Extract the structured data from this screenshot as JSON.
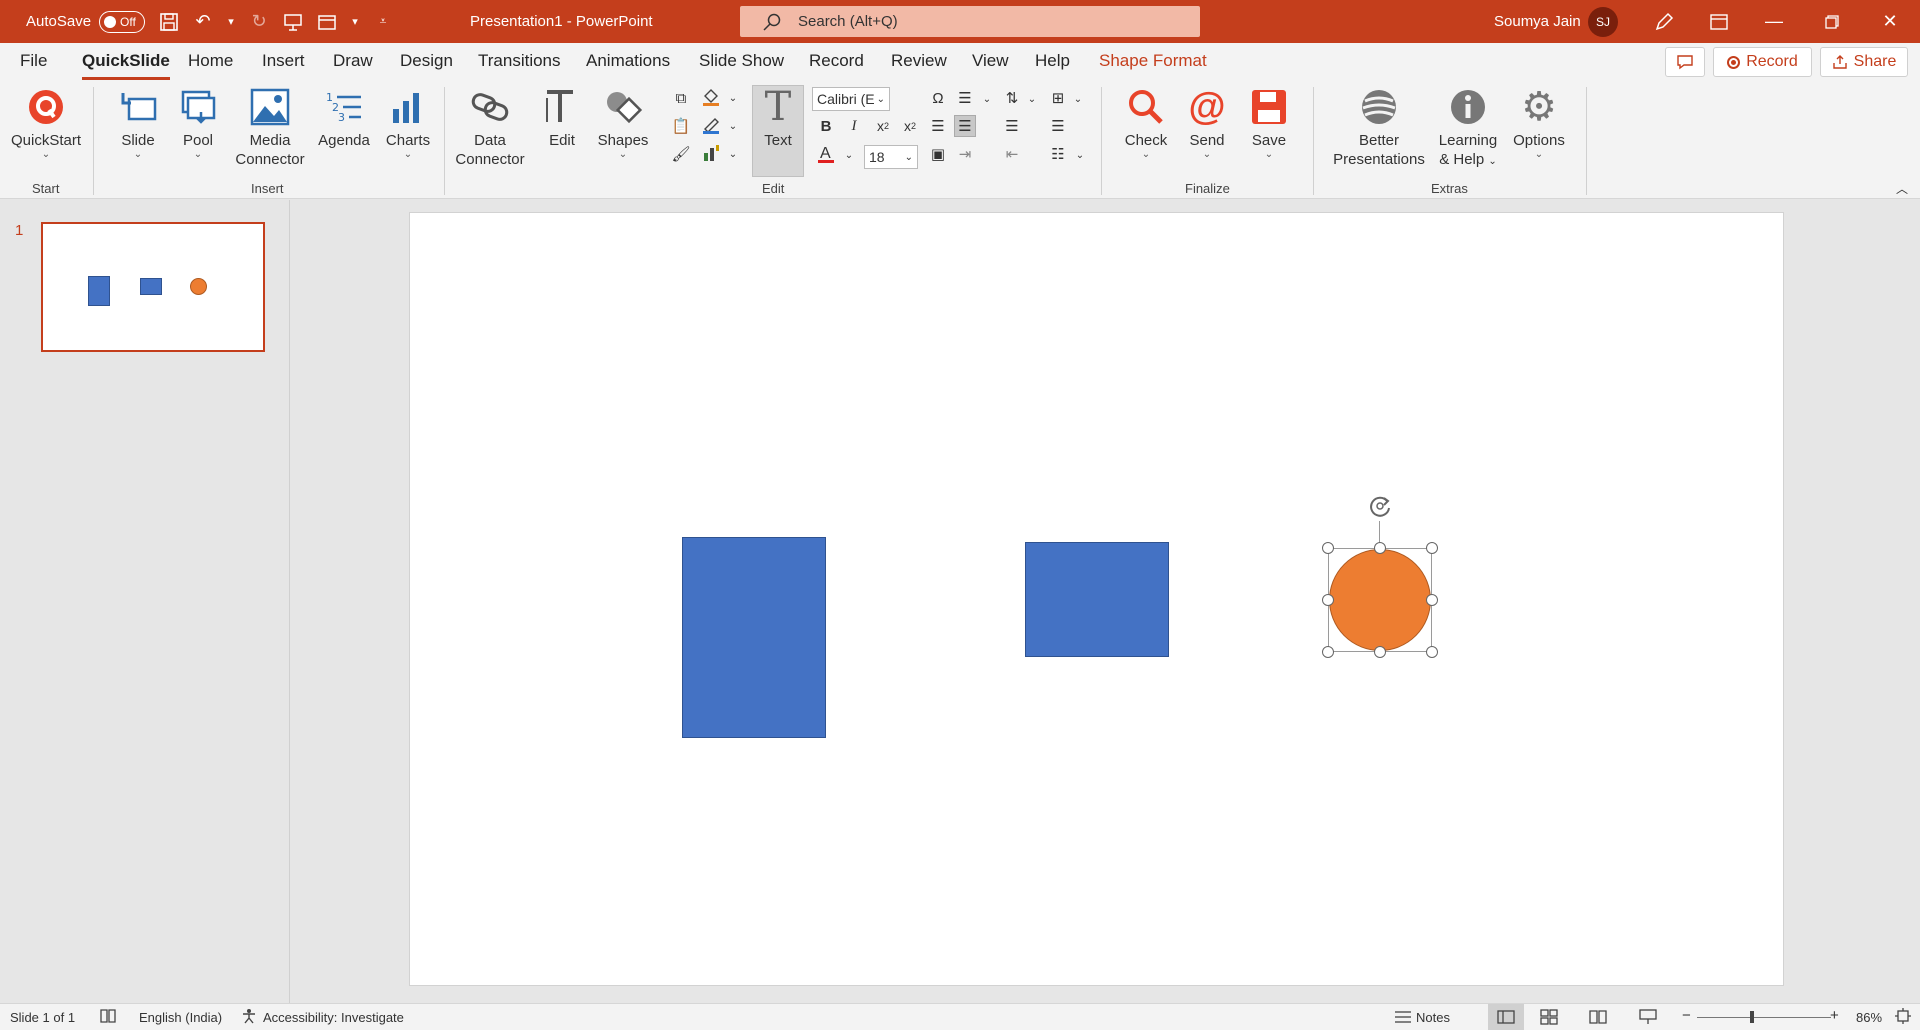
{
  "titlebar": {
    "autosave_label": "AutoSave",
    "autosave_state": "Off",
    "document_title": "Presentation1  -  PowerPoint",
    "search_placeholder": "Search (Alt+Q)",
    "user_name": "Soumya Jain",
    "user_initials": "SJ",
    "bg_color": "#c43e1c"
  },
  "tabs": [
    "File",
    "QuickSlide",
    "Home",
    "Insert",
    "Draw",
    "Design",
    "Transitions",
    "Animations",
    "Slide Show",
    "Record",
    "Review",
    "View",
    "Help",
    "Shape Format"
  ],
  "active_tab": "QuickSlide",
  "topright": {
    "record_label": "Record",
    "share_label": "Share"
  },
  "ribbon": {
    "start": {
      "quickstart": "QuickStart",
      "group": "Start"
    },
    "insert": {
      "slide": "Slide",
      "pool": "Pool",
      "media1": "Media",
      "media2": "Connector",
      "agenda": "Agenda",
      "charts": "Charts",
      "group": "Insert"
    },
    "edit": {
      "data1": "Data",
      "data2": "Connector",
      "edit": "Edit",
      "shapes": "Shapes",
      "text": "Text",
      "font_name": "Calibri (E",
      "font_size": "18",
      "group": "Edit"
    },
    "finalize": {
      "check": "Check",
      "send": "Send",
      "save": "Save",
      "group": "Finalize"
    },
    "extras": {
      "better1": "Better",
      "better2": "Presentations",
      "learning1": "Learning",
      "learning2": "& Help",
      "options": "Options",
      "group": "Extras"
    }
  },
  "slides_panel": {
    "slide_number": "1"
  },
  "slide": {
    "shapes": [
      {
        "type": "rectangle",
        "color": "#4472c4"
      },
      {
        "type": "rectangle",
        "color": "#4472c4"
      },
      {
        "type": "circle",
        "color": "#ed7d31",
        "selected": true
      }
    ]
  },
  "status": {
    "slide_info": "Slide 1 of 1",
    "language": "English (India)",
    "accessibility": "Accessibility: Investigate",
    "notes": "Notes",
    "zoom": "86%"
  }
}
